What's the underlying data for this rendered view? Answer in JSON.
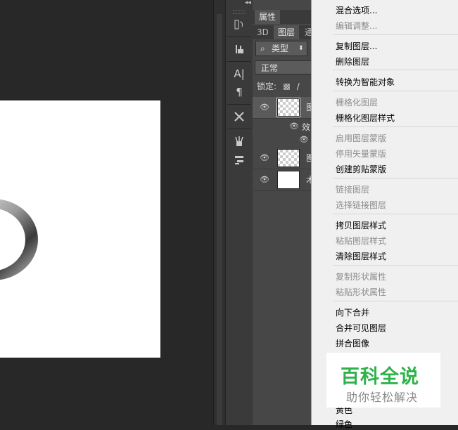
{
  "layers_panel": {
    "tabs_top": [
      "属性"
    ],
    "tabs": [
      "3D",
      "图层",
      "通"
    ],
    "filter_icon": "search-icon",
    "filter_label": "类型",
    "blend_mode": "正常",
    "lock_label": "锁定:",
    "layers": [
      {
        "name": "图",
        "thumbnail": "transparent",
        "visible": true,
        "selected": true
      },
      {
        "name": "效",
        "thumbnail": "none",
        "visible": true,
        "selected": false
      },
      {
        "name": "图",
        "thumbnail": "transparent",
        "visible": true,
        "selected": false
      },
      {
        "name": "术",
        "thumbnail": "white",
        "visible": true,
        "selected": false
      }
    ]
  },
  "tools": [
    "history-icon",
    "stamp-icon",
    "character-icon",
    "paragraph-icon",
    "tools-icon",
    "brush-presets-icon",
    "adjust-icon"
  ],
  "context_menu": {
    "items": [
      {
        "label": "混合选项...",
        "enabled": true
      },
      {
        "label": "编辑调整...",
        "enabled": false
      },
      {
        "label": "复制图层...",
        "enabled": true
      },
      {
        "label": "删除图层",
        "enabled": true
      },
      {
        "label": "转换为智能对象",
        "enabled": true
      },
      {
        "label": "栅格化图层",
        "enabled": false
      },
      {
        "label": "栅格化图层样式",
        "enabled": true
      },
      {
        "label": "启用图层蒙版",
        "enabled": false
      },
      {
        "label": "停用矢量蒙版",
        "enabled": false
      },
      {
        "label": "创建剪贴蒙版",
        "enabled": true
      },
      {
        "label": "链接图层",
        "enabled": false
      },
      {
        "label": "选择链接图层",
        "enabled": false
      },
      {
        "label": "拷贝图层样式",
        "enabled": true
      },
      {
        "label": "粘贴图层样式",
        "enabled": false
      },
      {
        "label": "清除图层样式",
        "enabled": true
      },
      {
        "label": "复制形状属性",
        "enabled": false
      },
      {
        "label": "粘贴形状属性",
        "enabled": false
      },
      {
        "label": "向下合并",
        "enabled": true
      },
      {
        "label": "合并可见图层",
        "enabled": true
      },
      {
        "label": "拼合图像",
        "enabled": true
      },
      {
        "label": "黄色",
        "enabled": true
      },
      {
        "label": "绿色",
        "enabled": true
      }
    ]
  },
  "watermark": {
    "title": "百科全说",
    "subtitle": "助你轻松解决",
    "title_color": "#2db34a"
  }
}
